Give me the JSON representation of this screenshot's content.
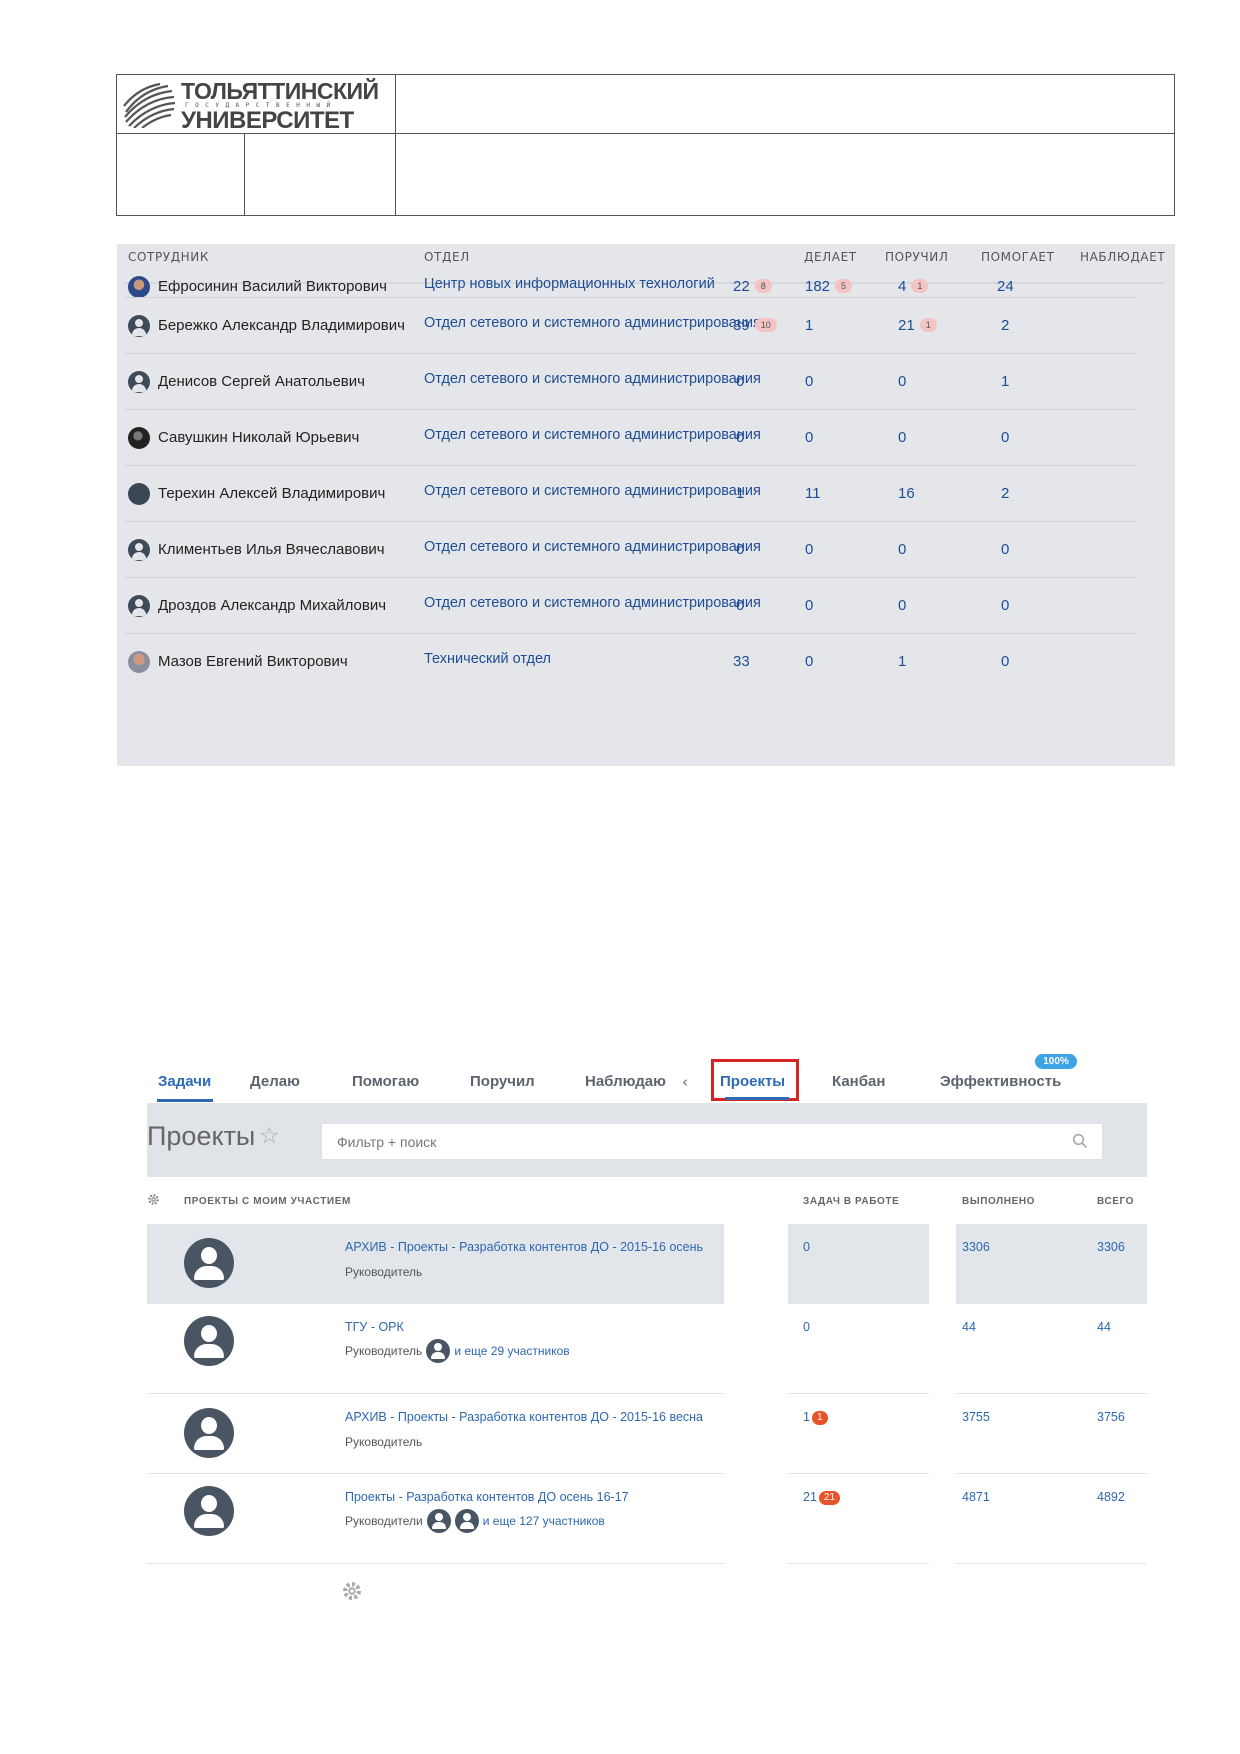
{
  "logo": {
    "line1": "ТОЛЬЯТТИНСКИЙ",
    "line2": "ГОСУДАРСТВЕННЫЙ",
    "line3": "УНИВЕРСИТЕТ"
  },
  "employees": {
    "headers": {
      "employee": "СОТРУДНИК",
      "department": "ОТДЕЛ",
      "doing": "ДЕЛАЕТ",
      "assigned": "ПОРУЧИЛ",
      "helping": "ПОМОГАЕТ",
      "watching": "НАБЛЮДАЕТ"
    },
    "rows": [
      {
        "name": "Ефросинин Василий Викторович",
        "department": "Центр новых информационных технологий",
        "doing": "22",
        "doing_badge": "8",
        "assigned": "182",
        "assigned_badge": "5",
        "helping": "4",
        "helping_badge": "1",
        "watching": "24",
        "avatar": "photo1"
      },
      {
        "name": "Бережко Александр Владимирович",
        "department": "Отдел сетевого и системного администрирования",
        "doing": "39",
        "doing_badge": "10",
        "assigned": "1",
        "assigned_badge": "",
        "helping": "21",
        "helping_badge": "1",
        "watching": "2",
        "avatar": "user-icon"
      },
      {
        "name": "Денисов Сергей Анатольевич",
        "department": "Отдел сетевого и системного администрирования",
        "doing": "0",
        "doing_badge": "",
        "assigned": "0",
        "assigned_badge": "",
        "helping": "0",
        "helping_badge": "",
        "watching": "1",
        "avatar": "user-icon"
      },
      {
        "name": "Савушкин Николай Юрьевич",
        "department": "Отдел сетевого и системного администрирования",
        "doing": "0",
        "doing_badge": "",
        "assigned": "0",
        "assigned_badge": "",
        "helping": "0",
        "helping_badge": "",
        "watching": "0",
        "avatar": "photo2"
      },
      {
        "name": "Терехин Алексей Владимирович",
        "department": "Отдел сетевого и системного администрирования",
        "doing": "1",
        "doing_badge": "",
        "assigned": "11",
        "assigned_badge": "",
        "helping": "16",
        "helping_badge": "",
        "watching": "2",
        "avatar": "plain"
      },
      {
        "name": "Климентьев Илья Вячеславович",
        "department": "Отдел сетевого и системного администрирования",
        "doing": "0",
        "doing_badge": "",
        "assigned": "0",
        "assigned_badge": "",
        "helping": "0",
        "helping_badge": "",
        "watching": "0",
        "avatar": "user-icon"
      },
      {
        "name": "Дроздов Александр Михайлович",
        "department": "Отдел сетевого и системного администрирования",
        "doing": "0",
        "doing_badge": "",
        "assigned": "0",
        "assigned_badge": "",
        "helping": "0",
        "helping_badge": "",
        "watching": "0",
        "avatar": "user-icon"
      },
      {
        "name": "Мазов Евгений Викторович",
        "department": "Технический отдел",
        "doing": "33",
        "doing_badge": "",
        "assigned": "0",
        "assigned_badge": "",
        "helping": "1",
        "helping_badge": "",
        "watching": "0",
        "avatar": "photo3"
      }
    ]
  },
  "tabs": {
    "tasks": "Задачи",
    "doing": "Делаю",
    "helping": "Помогаю",
    "assigned": "Поручил",
    "watching": "Наблюдаю",
    "arrow": "‹",
    "projects": "Проекты",
    "kanban": "Канбан",
    "efficiency": "Эффективность",
    "efficiency_badge": "100%"
  },
  "toolbar": {
    "title": "Проекты",
    "search_placeholder": "Фильтр + поиск"
  },
  "projects": {
    "headers": {
      "name": "ПРОЕКТЫ С МОИМ УЧАСТИЕМ",
      "in_work": "ЗАДАЧ В РАБОТЕ",
      "done": "ВЫПОЛНЕНО",
      "total": "ВСЕГО"
    },
    "rows": [
      {
        "name": "АРХИВ - Проекты - Разработка контентов ДО - 2015-16 осень",
        "role": "Руководитель",
        "more": "",
        "in_work": "0",
        "in_work_badge": "",
        "done": "3306",
        "total": "3306"
      },
      {
        "name": "ТГУ - ОРК",
        "role": "Руководитель",
        "more": "и еще 29 участников",
        "in_work": "0",
        "in_work_badge": "",
        "done": "44",
        "total": "44"
      },
      {
        "name": "АРХИВ - Проекты - Разработка контентов ДО - 2015-16 весна",
        "role": "Руководитель",
        "more": "",
        "in_work": "1",
        "in_work_badge": "1",
        "done": "3755",
        "total": "3756"
      },
      {
        "name": "Проекты - Разработка контентов ДО осень 16-17",
        "role": "Руководители",
        "more": "и еще 127 участников",
        "in_work": "21",
        "in_work_badge": "21",
        "done": "4871",
        "total": "4892"
      }
    ]
  }
}
